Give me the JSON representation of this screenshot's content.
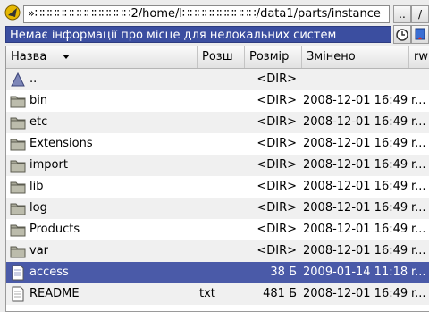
{
  "pathbar": {
    "path": "»∷∷∷∷∷∷∷∷∷∷∷∷∷2/home/l∷∷∷∷∷∷∷∷∷∷/data1/parts/instance",
    "up_label": "..",
    "root_label": "/"
  },
  "status": {
    "text": "Немає інформації про місце для нелокальних систем"
  },
  "columns": {
    "name": "Назва",
    "ext": "Розш",
    "size": "Розмір",
    "modified": "Змінено",
    "perms": "rw"
  },
  "files": [
    {
      "name": "..",
      "ext": "",
      "size": "<DIR>",
      "modified": "",
      "perms": "",
      "icon": "up-arrow-icon"
    },
    {
      "name": "bin",
      "ext": "",
      "size": "<DIR>",
      "modified": "2008-12-01 16:49",
      "perms": "r...",
      "icon": "folder-icon"
    },
    {
      "name": "etc",
      "ext": "",
      "size": "<DIR>",
      "modified": "2008-12-01 16:49",
      "perms": "r...",
      "icon": "folder-icon"
    },
    {
      "name": "Extensions",
      "ext": "",
      "size": "<DIR>",
      "modified": "2008-12-01 16:49",
      "perms": "r...",
      "icon": "folder-icon"
    },
    {
      "name": "import",
      "ext": "",
      "size": "<DIR>",
      "modified": "2008-12-01 16:49",
      "perms": "r...",
      "icon": "folder-icon"
    },
    {
      "name": "lib",
      "ext": "",
      "size": "<DIR>",
      "modified": "2008-12-01 16:49",
      "perms": "r...",
      "icon": "folder-icon"
    },
    {
      "name": "log",
      "ext": "",
      "size": "<DIR>",
      "modified": "2008-12-01 16:49",
      "perms": "r...",
      "icon": "folder-icon"
    },
    {
      "name": "Products",
      "ext": "",
      "size": "<DIR>",
      "modified": "2008-12-01 16:49",
      "perms": "r...",
      "icon": "folder-icon"
    },
    {
      "name": "var",
      "ext": "",
      "size": "<DIR>",
      "modified": "2008-12-01 16:49",
      "perms": "r...",
      "icon": "folder-icon"
    },
    {
      "name": "access",
      "ext": "",
      "size": "38 Б",
      "modified": "2009-01-14 11:18",
      "perms": "r...",
      "icon": "file-icon",
      "selected": true
    },
    {
      "name": "README",
      "ext": "txt",
      "size": "481 Б",
      "modified": "2008-12-01 16:49",
      "perms": "r...",
      "icon": "text-file-icon"
    }
  ],
  "colors": {
    "selection": "#4a5aa8",
    "status_bg": "#3b4ea0",
    "folder": "#9a9a86"
  }
}
